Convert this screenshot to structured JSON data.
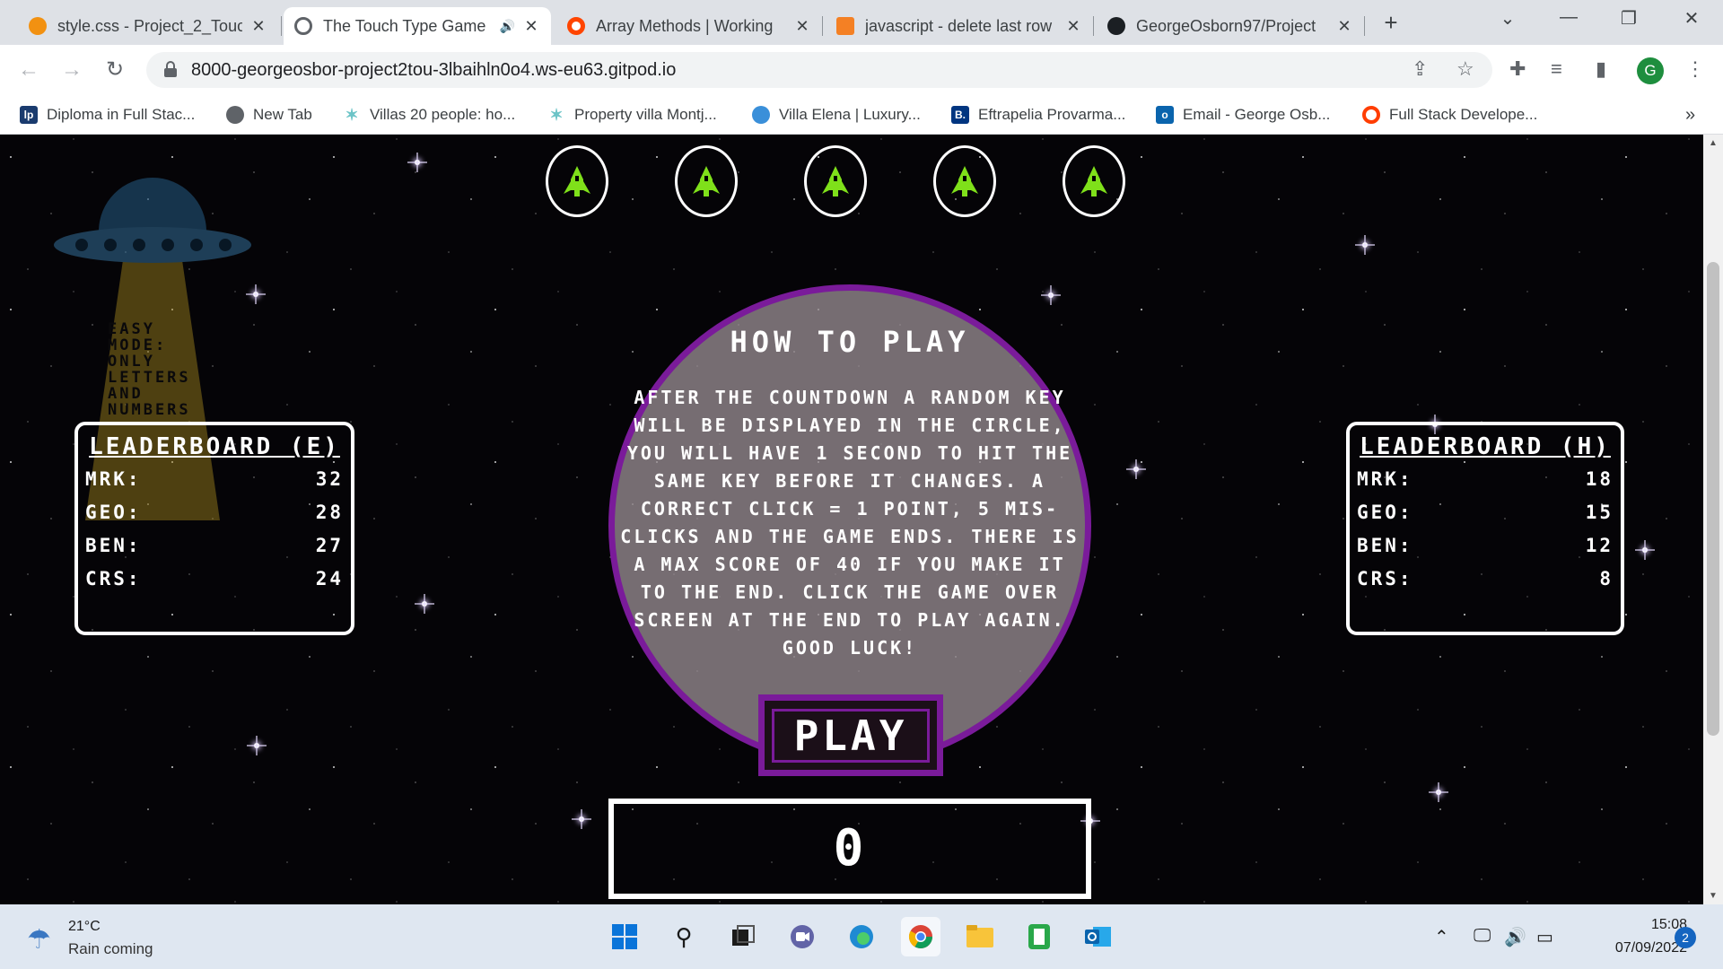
{
  "browser": {
    "tabs": [
      {
        "title": "style.css - Project_2_Touch",
        "favicon_color": "#f29111",
        "active": false
      },
      {
        "title": "The Touch Type Game",
        "favicon_color": "#5f6368",
        "active": true
      },
      {
        "title": "Array Methods | Working",
        "favicon_color": "#ff4500",
        "active": false
      },
      {
        "title": "javascript - delete last row",
        "favicon_color": "#f48024",
        "active": false
      },
      {
        "title": "GeorgeOsborn97/Project",
        "favicon_color": "#1b1f23",
        "active": false
      }
    ],
    "url": "8000-georgeosbor-project2tou-3lbaihln0o4.ws-eu63.gitpod.io",
    "profile_initial": "G",
    "bookmarks": [
      {
        "label": "Diploma in Full Stac...",
        "icon_color": "#1a3b6e",
        "icon_text": "lp"
      },
      {
        "label": "New Tab",
        "icon_color": "#5f6368",
        "icon_text": "◉"
      },
      {
        "label": "Villas 20 people: ho...",
        "icon_color": "#6cc4c7",
        "icon_text": "✶"
      },
      {
        "label": "Property villa Montj...",
        "icon_color": "#6cc4c7",
        "icon_text": "✶"
      },
      {
        "label": "Villa Elena | Luxury...",
        "icon_color": "#3a8fd9",
        "icon_text": "◔"
      },
      {
        "label": "Eftrapelia Provarma...",
        "icon_color": "#003580",
        "icon_text": "B."
      },
      {
        "label": "Email - George Osb...",
        "icon_color": "#0a64ad",
        "icon_text": "o"
      },
      {
        "label": "Full Stack Develope...",
        "icon_color": "#ff3d00",
        "icon_text": "○"
      }
    ]
  },
  "game": {
    "ufo_text": "EASY MODE: ONLY LETTERS AND NUMBERS",
    "lives": 5,
    "ship_color": "#7fe01a",
    "leaderboard_easy": {
      "title": "LEADERBOARD (E)",
      "rows": [
        {
          "name": "MRK:",
          "score": "32"
        },
        {
          "name": "GEO:",
          "score": "28"
        },
        {
          "name": "BEN:",
          "score": "27"
        },
        {
          "name": "CRS:",
          "score": "24"
        }
      ]
    },
    "leaderboard_hard": {
      "title": "LEADERBOARD (H)",
      "rows": [
        {
          "name": "MRK:",
          "score": "18"
        },
        {
          "name": "GEO:",
          "score": "15"
        },
        {
          "name": "BEN:",
          "score": "12"
        },
        {
          "name": "CRS:",
          "score": "8"
        }
      ]
    },
    "how_to_play": {
      "title": "HOW TO PLAY",
      "text": "AFTER THE COUNTDOWN A RANDOM KEY WILL BE DISPLAYED IN THE CIRCLE, YOU WILL HAVE 1 SECOND TO HIT THE SAME KEY BEFORE IT CHANGES. A CORRECT CLICK = 1 POINT, 5 MIS-CLICKS AND THE GAME ENDS. THERE IS A MAX SCORE OF 40 IF YOU MAKE IT TO THE END. CLICK THE GAME OVER SCREEN AT THE END TO PLAY AGAIN. GOOD LUCK!"
    },
    "play_label": "PLAY",
    "score": "0",
    "accent_color": "#7a1b9a"
  },
  "taskbar": {
    "weather_temp": "21°C",
    "weather_desc": "Rain coming",
    "time": "15:08",
    "date": "07/09/2022",
    "notifications": "2"
  }
}
